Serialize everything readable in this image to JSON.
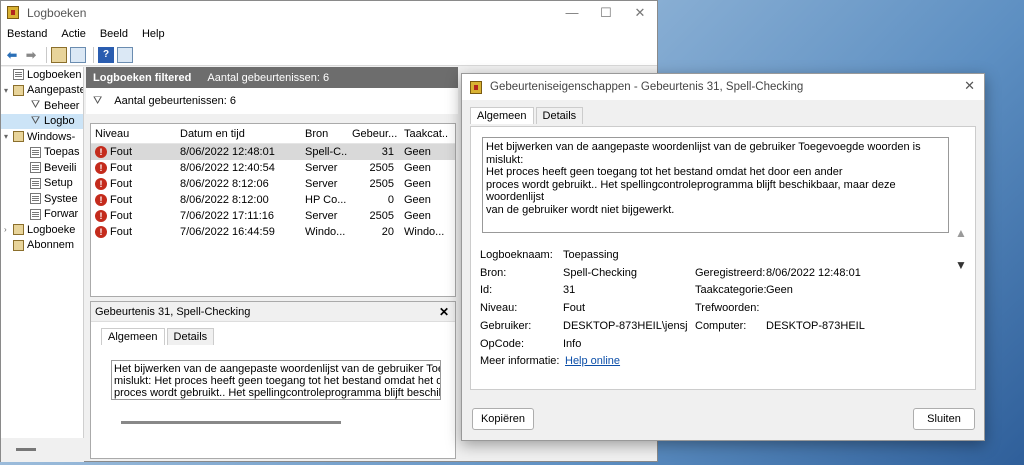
{
  "window": {
    "title": "Logboeken",
    "controls": [
      "—",
      "☐",
      "✕"
    ]
  },
  "menu": [
    "Bestand",
    "Actie",
    "Beeld",
    "Help"
  ],
  "tree": [
    {
      "label": "Logboeken (lo",
      "icon": "log",
      "exp": "",
      "indent": 0
    },
    {
      "label": "Aangepaste",
      "icon": "folder",
      "exp": "▾",
      "indent": 0
    },
    {
      "label": "Beheer",
      "icon": "filter",
      "exp": "",
      "indent": 1
    },
    {
      "label": "Logbo",
      "icon": "filter",
      "exp": "",
      "indent": 1,
      "selected": true
    },
    {
      "label": "Windows-",
      "icon": "folder",
      "exp": "▾",
      "indent": 0
    },
    {
      "label": "Toepas",
      "icon": "log",
      "exp": "",
      "indent": 1
    },
    {
      "label": "Beveili",
      "icon": "log",
      "exp": "",
      "indent": 1
    },
    {
      "label": "Setup",
      "icon": "log",
      "exp": "",
      "indent": 1
    },
    {
      "label": "Systee",
      "icon": "log",
      "exp": "",
      "indent": 1
    },
    {
      "label": "Forwar",
      "icon": "log",
      "exp": "",
      "indent": 1
    },
    {
      "label": "Logboeke",
      "icon": "folder",
      "exp": "›",
      "indent": 0
    },
    {
      "label": "Abonnem",
      "icon": "folder",
      "exp": "",
      "indent": 0
    }
  ],
  "center": {
    "header_title": "Logboeken filtered",
    "header_count": "Aantal gebeurtenissen: 6",
    "filter_text": "Aantal gebeurtenissen: 6"
  },
  "grid": {
    "columns": [
      "Niveau",
      "Datum en tijd",
      "Bron",
      "Gebeur...",
      "Taakcat..."
    ],
    "rows": [
      {
        "level": "Fout",
        "date": "8/06/2022 12:48:01",
        "source": "Spell-C...",
        "id": "31",
        "task": "Geen",
        "selected": true
      },
      {
        "level": "Fout",
        "date": "8/06/2022 12:40:54",
        "source": "Server",
        "id": "2505",
        "task": "Geen"
      },
      {
        "level": "Fout",
        "date": "8/06/2022 8:12:06",
        "source": "Server",
        "id": "2505",
        "task": "Geen"
      },
      {
        "level": "Fout",
        "date": "8/06/2022 8:12:00",
        "source": "HP Co...",
        "id": "0",
        "task": "Geen"
      },
      {
        "level": "Fout",
        "date": "7/06/2022 17:11:16",
        "source": "Server",
        "id": "2505",
        "task": "Geen"
      },
      {
        "level": "Fout",
        "date": "7/06/2022 16:44:59",
        "source": "Windo...",
        "id": "20",
        "task": "Windo..."
      }
    ]
  },
  "detail": {
    "title": "Gebeurtenis 31, Spell-Checking",
    "close": "✕",
    "tab_general": "Algemeen",
    "tab_details": "Details",
    "lines": [
      "Het bijwerken van de aangepaste woordenlijst van de gebruiker Toegevo",
      "mislukt: Het proces heeft geen toegang tot het bestand omdat het door",
      "proces wordt gebruikt.. Het spellingcontroleprogramma blijft beschikbaa"
    ]
  },
  "dialog": {
    "title": "Gebeurteniseigenschappen - Gebeurtenis 31, Spell-Checking",
    "close": "✕",
    "tab_general": "Algemeen",
    "tab_details": "Details",
    "message_lines": [
      "Het bijwerken van de aangepaste woordenlijst van de gebruiker Toegevoegde woorden is mislukt:",
      "Het proces heeft geen toegang tot het bestand omdat het door een ander",
      "proces wordt gebruikt.. Het spellingcontroleprogramma blijft beschikbaar, maar deze woordenlijst",
      "van de gebruiker wordt niet bijgewerkt."
    ],
    "log_name_label": "Logboeknaam:",
    "log_name": "Toepassing",
    "source_label": "Bron:",
    "source": "Spell-Checking",
    "logged_label": "Geregistreerd:",
    "logged": "8/06/2022 12:48:01",
    "id_label": "Id:",
    "id": "31",
    "task_label": "Taakcategorie:",
    "task": "Geen",
    "level_label": "Niveau:",
    "level": "Fout",
    "keywords_label": "Trefwoorden:",
    "keywords": "",
    "user_label": "Gebruiker:",
    "user": "DESKTOP-873HEIL\\jensj",
    "computer_label": "Computer:",
    "computer": "DESKTOP-873HEIL",
    "opcode_label": "OpCode:",
    "opcode": "Info",
    "more_info_label": "Meer informatie:",
    "more_info_link": "Help online",
    "copy_button": "Kopiëren",
    "close_button": "Sluiten"
  }
}
